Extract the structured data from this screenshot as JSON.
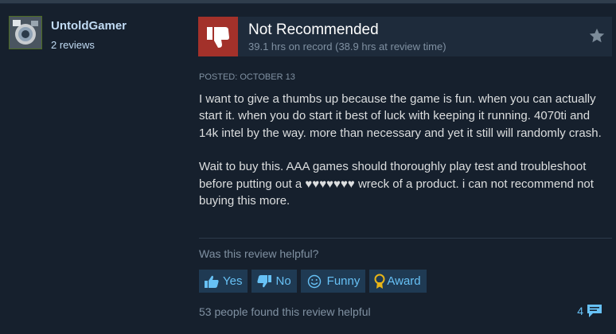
{
  "author": {
    "name": "UntoldGamer",
    "reviews": "2 reviews"
  },
  "review": {
    "verdict": "Not Recommended",
    "hours": "39.1 hrs on record (38.9 hrs at review time)",
    "posted": "POSTED: OCTOBER 13",
    "paragraphs": [
      "I want to give a thumbs up because the game is fun. when you can actually start it. when you do start it best of luck with keeping it running. 4070ti and 14k intel by the way. more than necessary and yet it still will randomly crash.",
      "Wait to buy this. AAA games should thoroughly play test and troubleshoot before putting out a ♥♥♥♥♥♥♥ wreck of a product. i can not recommend not buying this more."
    ]
  },
  "feedback": {
    "question": "Was this review helpful?",
    "buttons": {
      "yes": "Yes",
      "no": "No",
      "funny": "Funny",
      "award": "Award"
    },
    "found_helpful": "53 people found this review helpful",
    "comment_count": "4"
  },
  "colors": {
    "background": "#1b2838",
    "thumbs_down": "#a3312a",
    "button_bg": "#1f3a53",
    "link_blue": "#67c1f5",
    "award_gold": "#e8b517"
  },
  "icons": [
    "thumbs-down-icon",
    "star-icon",
    "thumbs-up-icon",
    "smiley-icon",
    "award-icon",
    "comment-icon"
  ]
}
